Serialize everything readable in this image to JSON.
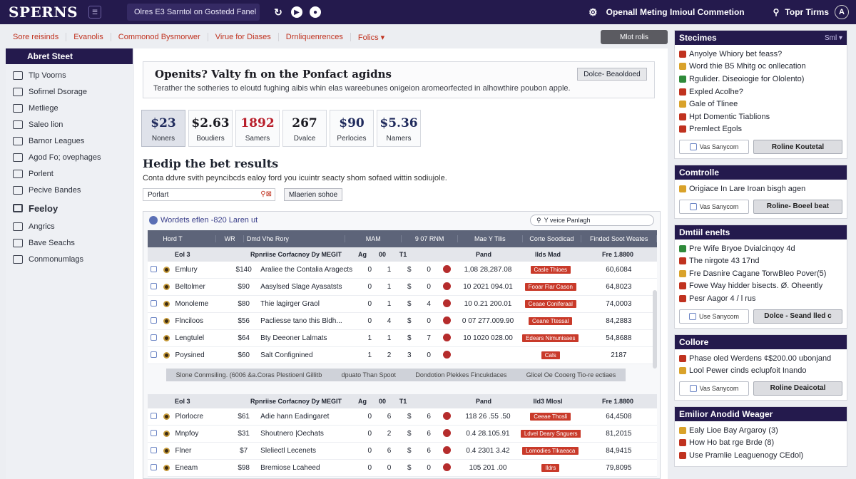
{
  "topbar": {
    "logo": "SPERNS",
    "menu_icon": "menu-icon",
    "search_text": "Olres E3 Sarntol on Gostedd Fanel",
    "right_label": "Openall Meting Imioul Commetion",
    "right_label_2": "Topr Tirms"
  },
  "subnav": {
    "items": [
      "Sore reisinds",
      "Evanolis",
      "Commonod Bysmorwer",
      "Virue for Diases",
      "Drnliquenrences",
      "Folics ▾"
    ],
    "right_button": "Mlot rolis"
  },
  "sidebar": {
    "header": "Abret Steet",
    "items": [
      "Tlp Voorns",
      "Sofirnel Dsorage",
      "Metliege",
      "Saleo lion",
      "Barnor Leagues",
      "Agod Fo; ovephages",
      "Porlent",
      "Pecive Bandes"
    ],
    "section": "Feeloy",
    "items2": [
      "Angrics",
      "Bave Seachs",
      "Conmonumlags"
    ]
  },
  "promo": {
    "title": "Openits? Valty fn on the Ponfact agidns",
    "desc": "Terather the sotheries to eloutd fughing aibis whin elas wareebunes onigeion aromeorfected in alhowthire poubon apple.",
    "button": "Dolce- Beaoldoed"
  },
  "stats": [
    {
      "value": "$23",
      "label": "Noners",
      "color": "#1f2a5c"
    },
    {
      "value": "$2.63",
      "label": "Boudiers",
      "color": "#1b1b22"
    },
    {
      "value": "1892",
      "label": "Samers",
      "color": "#b81e2a"
    },
    {
      "value": "267",
      "label": "Dvalce",
      "color": "#1b1b22"
    },
    {
      "value": "$90",
      "label": "Perlocies",
      "color": "#1f2a5c"
    },
    {
      "value": "$5.36",
      "label": "Namers",
      "color": "#1f2a5c"
    }
  ],
  "section": {
    "title": "Hedip the bet results",
    "desc": "Conta ddvre svith peyncibcds  ealoy ford you icuintr seacty shom sofaed wittin sodiujole.",
    "select_value": "Porlart",
    "select_button": "Mlaerien sohoe"
  },
  "table": {
    "caption": "Wordets eflen -820 Laren ut",
    "filter_placeholder": "Y veice Panlagh",
    "headers": [
      "Hord T",
      "WR",
      "Dmd Vhe Rory",
      "MAM",
      "9 07 RNM",
      "Mae Y Tilis",
      "Corte Soodicad",
      "Finded Soot Weates"
    ],
    "group1": {
      "sub": [
        "Eol 3",
        "Rpnriise Corfacnoy Dy MEGIT",
        "Ag",
        "00",
        "T1",
        "Pand",
        "Ilds Mad",
        "Fre 1.8800"
      ],
      "rows": [
        {
          "name": "Emlury",
          "wr": "$140",
          "desc": "Araliee the Contalia Aragects",
          "a": "0",
          "b": "1",
          "d": "$",
          "e": "0",
          "date": "1,08 28,287.08",
          "badge": "Casle Thioes",
          "score": "60,6084"
        },
        {
          "name": "Beltolmer",
          "wr": "$90",
          "desc": "Aasylsed Slage Ayasatsts",
          "a": "0",
          "b": "1",
          "d": "$",
          "e": "0",
          "date": "10 2021 094.01",
          "badge": "Fooar Flar Cason",
          "score": "64,8023"
        },
        {
          "name": "Monoleme",
          "wr": "$80",
          "desc": "Thie lagirger Graol",
          "a": "0",
          "b": "1",
          "d": "$",
          "e": "4",
          "date": "10 0.21 200.01",
          "badge": "Ceaae Coniferaal",
          "score": "74,0003"
        },
        {
          "name": "Flnciloos",
          "wr": "$56",
          "desc": "Pacliesse tano this Bldh...",
          "a": "0",
          "b": "4",
          "d": "$",
          "e": "0",
          "date": "0 07 277.009.90",
          "badge": "Ceane Ttessal",
          "score": "84,2883"
        },
        {
          "name": "Lengtulel",
          "wr": "$64",
          "desc": "Bty Deeoner Lalmats",
          "a": "1",
          "b": "1",
          "d": "$",
          "e": "7",
          "date": "10 1020 028.00",
          "badge": "Edears Nimunisaes",
          "score": "54,8688"
        },
        {
          "name": "Poysined",
          "wr": "$60",
          "desc": "Salt Confignined",
          "a": "1",
          "b": "2",
          "d": "3",
          "e": "0",
          "date": "",
          "badge": "Cals",
          "score": "2187"
        }
      ],
      "footer": [
        "Slone Conmsiling. (6006 &a.Coras Plestioenl Gillitb",
        "dpuato Than Spoot",
        "Dondotion Plekkes Fincukdaces",
        "Glicel Oe Cooerg Tio-re ectiaes"
      ]
    },
    "group2": {
      "sub": [
        "Eol 3",
        "Rpnriise Corfacnoy Dy MEGIT",
        "Ag",
        "00",
        "T1",
        "Pand",
        "Ild3 Mlosl",
        "Fre 1.8800"
      ],
      "rows": [
        {
          "name": "Plorlocre",
          "wr": "$61",
          "desc": "Adie hann Eadingaret",
          "a": "0",
          "b": "6",
          "d": "$",
          "e": "6",
          "date": "118 26 .55 .50",
          "badge": "Ceeae Thosli",
          "score": "64,4508"
        },
        {
          "name": "Mnpfoy",
          "wr": "$31",
          "desc": "Shoutnero |Oechats",
          "a": "0",
          "b": "2",
          "d": "$",
          "e": "6",
          "date": "0.4 28.105.91",
          "badge": "Ldvel Deary Snguers",
          "score": "81,2015"
        },
        {
          "name": "Flner",
          "wr": "$7",
          "desc": "Sleliectl Lecenets",
          "a": "0",
          "b": "6",
          "d": "$",
          "e": "6",
          "date": "0.4 2301 3.42",
          "badge": "Lomodies Tlkaeaca",
          "score": "84,9415"
        },
        {
          "name": "Eneam",
          "wr": "$98",
          "desc": "Bremiose Lcaheed",
          "a": "0",
          "b": "0",
          "d": "$",
          "e": "0",
          "date": "105 201 .00",
          "badge": "Ildrs",
          "score": "79,8095"
        }
      ]
    }
  },
  "rpanel": {
    "cards": [
      {
        "title": "Stecimes",
        "title_right": "Sml ▾",
        "items": [
          "Anyolye Whiory bet feass?",
          "Word thie B5 Mhitg oc onllecation",
          "Rgulider. Diseoiogie for Ololento)",
          "Expled Acolhe?",
          "Gale of Tlinee",
          "Hpt Domentic Tiablions",
          "Premlect Egols"
        ],
        "btn1": "Vas Sanycom",
        "btn2": "Roline Koutetal"
      },
      {
        "title": "Comtrolle",
        "title_right": "",
        "items": [
          "Origiace In Lare Iroan bisgh agen"
        ],
        "btn1": "Vas Sanycom",
        "btn2": "Roline- Boeel beat"
      },
      {
        "title": "Dmtiil enelts",
        "title_right": "",
        "items": [
          "Pre Wife Bryoe Dvialcinqoy 4d",
          "The nirgote 43 17nd",
          "Fre Dasnire Cagane TorwBleo Pover(5)",
          "Fowe Way hidder bisects. Ø. Oheently",
          "Pesr Aagor 4 / l rus"
        ],
        "btn1": "Use Sanycom",
        "btn2": "Dolce - Seand lled c"
      },
      {
        "title": "Collore",
        "title_right": "",
        "items": [
          "Phase oled Werdens ¢$200.00 ubonjand",
          "Lool Pewer cinds eclupfoit Inando"
        ],
        "btn1": "Vas Sanycom",
        "btn2": "Roline Deaicotal"
      },
      {
        "title": "Emilior Anodid Weager",
        "title_right": "",
        "items": [
          "Ealy Lioe Bay Argaroy (3)",
          "How Ho bat rge Brde (8)",
          "Use Pramlie Leaguenogy CEdol)"
        ],
        "btn1": "",
        "btn2": ""
      }
    ]
  },
  "colors": {
    "brand": "#241a4d",
    "accent_red": "#c0321f",
    "table_header": "#5d6479"
  }
}
